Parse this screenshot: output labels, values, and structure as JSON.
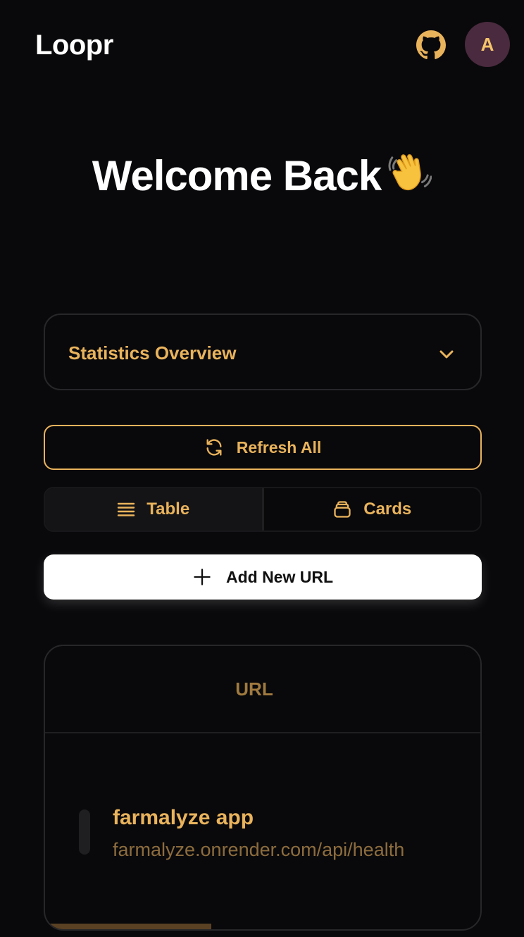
{
  "app": {
    "title": "Loopr"
  },
  "header": {
    "github_icon": "github-icon",
    "avatar_initial": "A"
  },
  "welcome": {
    "title": "Welcome Back",
    "emoji": "waving-hand"
  },
  "stats": {
    "title": "Statistics Overview",
    "expanded": false
  },
  "actions": {
    "refresh_label": "Refresh All",
    "add_url_label": "Add New URL"
  },
  "view_toggle": {
    "options": [
      {
        "label": "Table",
        "icon": "list-icon",
        "active": true
      },
      {
        "label": "Cards",
        "icon": "cards-icon",
        "active": false
      }
    ]
  },
  "table": {
    "columns": [
      "URL"
    ],
    "rows": [
      {
        "name": "farmalyze app",
        "url": "farmalyze.onrender.com/api/health"
      }
    ]
  },
  "colors": {
    "accent": "#e9b35c",
    "background": "#09090b",
    "avatar_bg": "#4a2a3e"
  }
}
